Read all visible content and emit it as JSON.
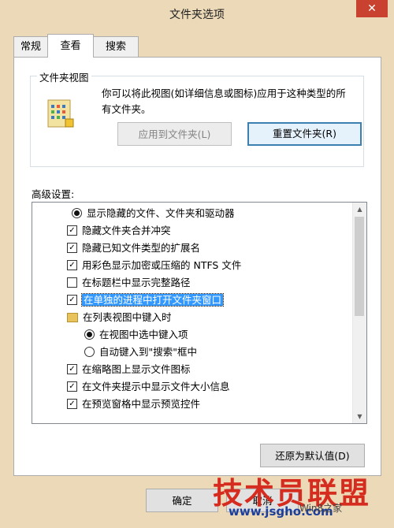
{
  "window": {
    "title": "文件夹选项",
    "close_glyph": "✕"
  },
  "tabs": [
    {
      "label": "常规",
      "active": false
    },
    {
      "label": "查看",
      "active": true
    },
    {
      "label": "搜索",
      "active": false
    }
  ],
  "folder_views": {
    "legend": "文件夹视图",
    "description": "你可以将此视图(如详细信息或图标)应用于这种类型的所有文件夹。",
    "apply_button": "应用到文件夹(L)",
    "reset_button": "重置文件夹(R)"
  },
  "advanced": {
    "label": "高级设置:",
    "items": [
      {
        "type": "radio",
        "checked": true,
        "label": "显示隐藏的文件、文件夹和驱动器"
      },
      {
        "type": "checkbox",
        "checked": true,
        "label": "隐藏文件夹合并冲突"
      },
      {
        "type": "checkbox",
        "checked": true,
        "label": "隐藏已知文件类型的扩展名"
      },
      {
        "type": "checkbox",
        "checked": true,
        "label": "用彩色显示加密或压缩的 NTFS 文件"
      },
      {
        "type": "checkbox",
        "checked": false,
        "label": "在标题栏中显示完整路径"
      },
      {
        "type": "checkbox",
        "checked": true,
        "label": "在单独的进程中打开文件夹窗口",
        "selected": true
      },
      {
        "type": "folder",
        "label": "在列表视图中键入时"
      },
      {
        "type": "radio",
        "checked": true,
        "label": "在视图中选中键入项"
      },
      {
        "type": "radio",
        "checked": false,
        "label": "自动键入到\"搜索\"框中"
      },
      {
        "type": "checkbox",
        "checked": true,
        "label": "在缩略图上显示文件图标"
      },
      {
        "type": "checkbox",
        "checked": true,
        "label": "在文件夹提示中显示文件大小信息"
      },
      {
        "type": "checkbox",
        "checked": true,
        "label": "在预览窗格中显示预览控件"
      }
    ],
    "restore_button": "还原为默认值(D)"
  },
  "footer": {
    "ok_button": "确定",
    "cancel_button": "取消"
  },
  "watermark": {
    "main": "技术员联盟",
    "url": "www.jsgho.com",
    "sub": "Win8之家"
  }
}
